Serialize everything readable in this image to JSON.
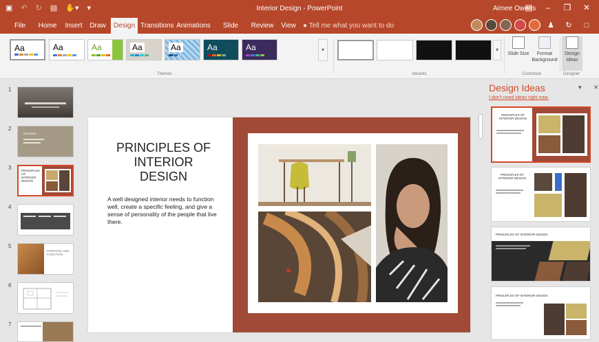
{
  "app": {
    "document_title": "Interior Design - PowerPoint",
    "user_name": "Aimee Owens"
  },
  "tabs": [
    {
      "label": "File"
    },
    {
      "label": "Home"
    },
    {
      "label": "Insert"
    },
    {
      "label": "Draw"
    },
    {
      "label": "Design"
    },
    {
      "label": "Transitions"
    },
    {
      "label": "Animations"
    },
    {
      "label": "Slide Show"
    },
    {
      "label": "Review"
    },
    {
      "label": "View"
    }
  ],
  "active_tab": "Design",
  "tell_me": "Tell me what you want to do",
  "ribbon": {
    "themes_label": "Themes",
    "variants_label": "Variants",
    "customize_label": "Customize",
    "designer_label": "Designer",
    "theme_text": "Aa",
    "slide_size": "Slide Size",
    "format_background_1": "Format",
    "format_background_2": "Background",
    "design_ideas_1": "Design",
    "design_ideas_2": "Ideas"
  },
  "thumbnails": [
    {
      "num": "1"
    },
    {
      "num": "2",
      "text": "CLASSIC"
    },
    {
      "num": "3",
      "text": "PRINCIPLES OF INTERIOR DESIGN"
    },
    {
      "num": "4"
    },
    {
      "num": "5",
      "text": "PURPOSE AND FUNCTION"
    },
    {
      "num": "6"
    },
    {
      "num": "7"
    }
  ],
  "selected_slide": 3,
  "slide": {
    "title": "PRINCIPLES OF INTERIOR DESIGN",
    "body": "A well designed interior needs to function well, create a specific feeling, and give a sense of personality of the people that live there."
  },
  "design_ideas": {
    "title": "Design Ideas",
    "link": "I don't need ideas right now.",
    "idea_title_short": "PRINCIPLES OF INTERIOR DESIGN",
    "idea_title_long": "PRINCIPLES OF INTERIOR DESIGN"
  },
  "colors": {
    "accent": "#b7472a",
    "band": "#a04a37",
    "design_ideas_orange": "#d24726"
  }
}
